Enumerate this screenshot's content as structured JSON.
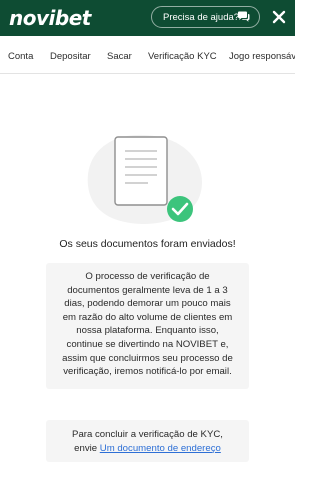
{
  "header": {
    "logo": "novibet",
    "help_label": "Precisa de ajuda?",
    "help_icon": "chat-icon",
    "close_icon": "close-icon",
    "background_color": "#0e4c33"
  },
  "tabs": [
    {
      "label": "Conta"
    },
    {
      "label": "Depositar"
    },
    {
      "label": "Sacar"
    },
    {
      "label": "Verificação KYC"
    },
    {
      "label": "Jogo responsável"
    }
  ],
  "main": {
    "illustration_icon": "document-check-icon",
    "sent_message": "Os seus documentos foram enviados!",
    "info_line1": "O processo de verificação de",
    "info_line2": "documentos geralmente leva de 1 a 3",
    "info_line3": "dias, podendo demorar um pouco mais",
    "info_line4": "em razão do alto volume de clientes em",
    "info_line5": "nossa plataforma. Enquanto isso,",
    "info_line6": "continue se divertindo na NOVIBET e,",
    "info_line7": "assim que concluirmos seu processo de",
    "info_line8": "verificação, iremos notificá-lo por email.",
    "kyc_line1": "Para concluir a verificação de KYC,",
    "kyc_prefix": "envie ",
    "kyc_link": "Um documento de endereço",
    "link_color": "#2d6fd6",
    "check_color": "#3cc47c"
  }
}
